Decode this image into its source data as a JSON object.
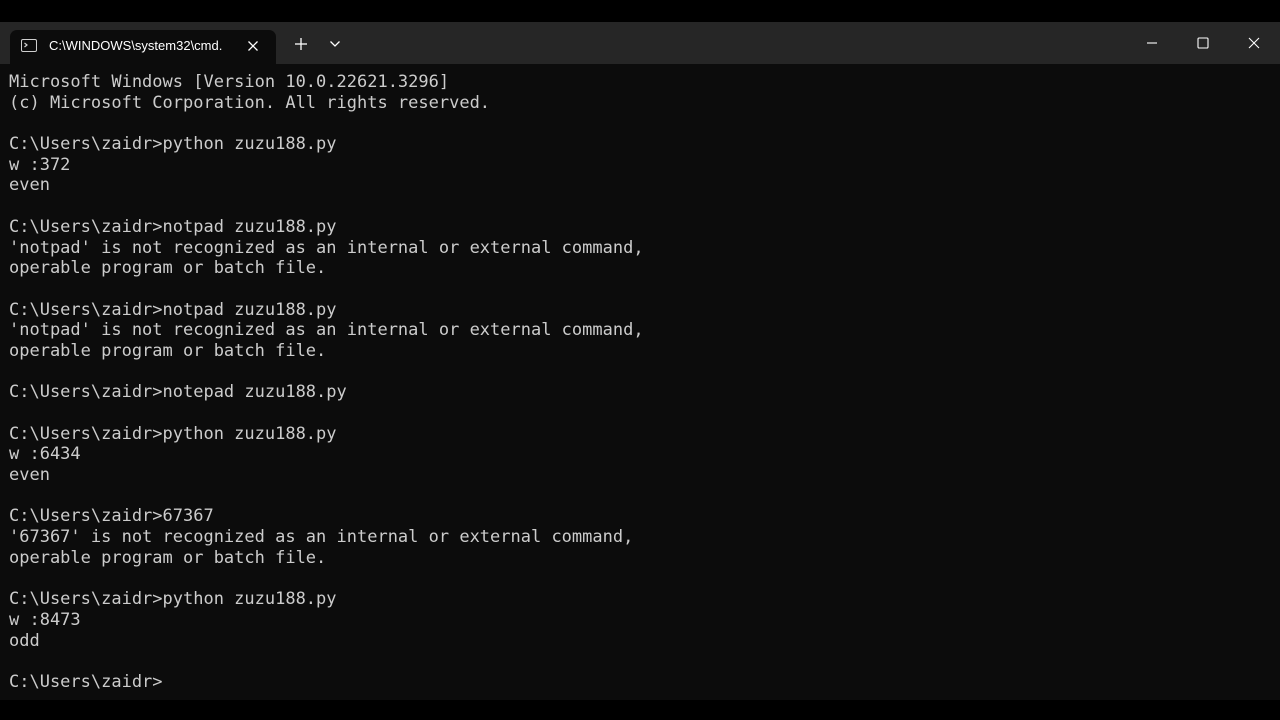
{
  "window": {
    "tab_title": "C:\\WINDOWS\\system32\\cmd.",
    "tab_icon": "terminal-icon",
    "new_tab_icon": "plus-icon",
    "dropdown_icon": "chevron-down-icon",
    "minimize_icon": "minimize-icon",
    "maximize_icon": "maximize-icon",
    "close_icon": "close-icon"
  },
  "colors": {
    "terminal_bg": "#0c0c0c",
    "titlebar_bg": "#262626",
    "text": "#cccccc"
  },
  "terminal": {
    "lines": [
      "Microsoft Windows [Version 10.0.22621.3296]",
      "(c) Microsoft Corporation. All rights reserved.",
      "",
      "C:\\Users\\zaidr>python zuzu188.py",
      "w :372",
      "even",
      "",
      "C:\\Users\\zaidr>notpad zuzu188.py",
      "'notpad' is not recognized as an internal or external command,",
      "operable program or batch file.",
      "",
      "C:\\Users\\zaidr>notpad zuzu188.py",
      "'notpad' is not recognized as an internal or external command,",
      "operable program or batch file.",
      "",
      "C:\\Users\\zaidr>notepad zuzu188.py",
      "",
      "C:\\Users\\zaidr>python zuzu188.py",
      "w :6434",
      "even",
      "",
      "C:\\Users\\zaidr>67367",
      "'67367' is not recognized as an internal or external command,",
      "operable program or batch file.",
      "",
      "C:\\Users\\zaidr>python zuzu188.py",
      "w :8473",
      "odd",
      "",
      "C:\\Users\\zaidr>"
    ]
  }
}
